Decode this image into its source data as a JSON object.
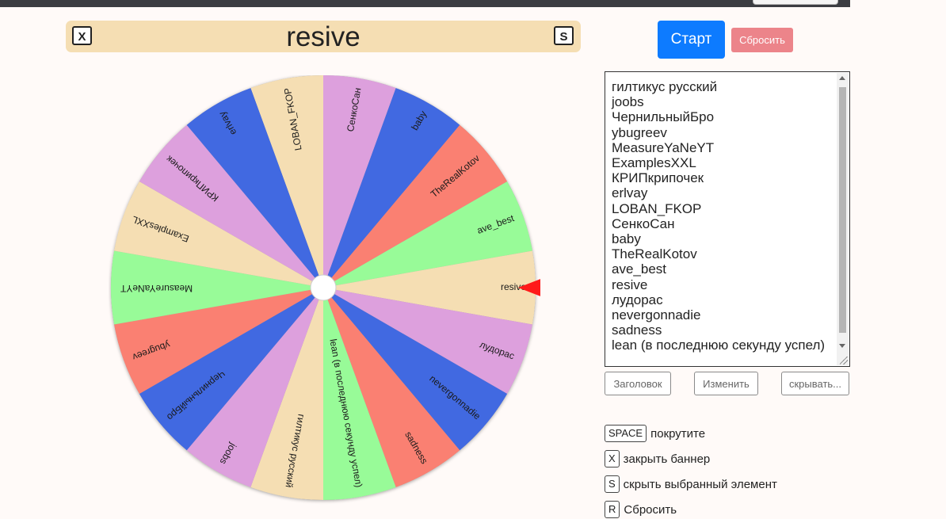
{
  "app": {
    "selected": "resive",
    "close_key": "X",
    "hide_key": "S"
  },
  "controls": {
    "start_label": "Старт",
    "reset_label": "Сбросить",
    "accent": "#0d7bff",
    "reset_color": "#ec848a"
  },
  "wheel": {
    "colors": [
      "#f5deb3",
      "#dda0dd",
      "#4169e1",
      "#fa8072",
      "#98fb98"
    ],
    "segments": [
      "LOBAN_FKOP",
      "СенкоСан",
      "baby",
      "TheRealKotov",
      "ave_best",
      "resive",
      "лудорас",
      "nevergonnadie",
      "sadness",
      "lean (в последнюю секунду успел)",
      "гилтикус русский",
      "joobs",
      "ЧернильныйБро",
      "ybugreev",
      "MeasureYaNeYT",
      "ExamplesXXL",
      "КРИПкрипочек",
      "erlvay"
    ],
    "pointer_color": "#ff1a1a"
  },
  "list": {
    "items": [
      "гилтикус русский",
      "joobs",
      "ЧернильныйБро",
      "ybugreev",
      "MeasureYaNeYT",
      "ExamplesXXL",
      "КРИПкрипочек",
      "erlvay",
      "LOBAN_FKOP",
      "СенкоСан",
      "baby",
      "TheRealKotov",
      "ave_best",
      "resive",
      "лудорас",
      "nevergonnadie",
      "sadness",
      "lean (в последнюю секунду успел)"
    ]
  },
  "buttons": {
    "title_label": "Заголовок",
    "edit_label": "Изменить",
    "hide_label": "скрывать..."
  },
  "hints": [
    {
      "key": "SPACE",
      "text": "покрутите"
    },
    {
      "key": "X",
      "text": "закрыть баннер"
    },
    {
      "key": "S",
      "text": "скрыть выбранный элемент"
    },
    {
      "key": "R",
      "text": "Сбросить"
    }
  ]
}
